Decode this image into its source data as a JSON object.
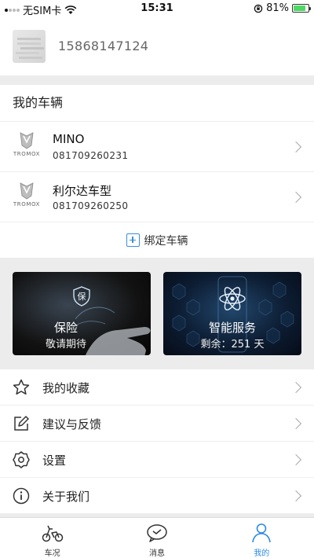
{
  "status_bar": {
    "carrier": "无SIM卡",
    "time": "15:31",
    "battery": "81%",
    "battery_level": 0.81
  },
  "profile": {
    "phone": "15868147124"
  },
  "vehicles_section": {
    "title": "我的车辆",
    "items": [
      {
        "name": "MINO",
        "serial": "081709260231",
        "brand": "TROMOX"
      },
      {
        "name": "利尔达车型",
        "serial": "081709260250",
        "brand": "TROMOX"
      }
    ],
    "bind_label": "绑定车辆"
  },
  "cards": {
    "insurance": {
      "title": "保险",
      "subtitle": "敬请期待",
      "badge": "保"
    },
    "service": {
      "title": "智能服务",
      "subtitle": "剩余：251 天"
    }
  },
  "menu": [
    {
      "label": "我的收藏",
      "icon": "star-icon"
    },
    {
      "label": "建议与反馈",
      "icon": "edit-icon"
    },
    {
      "label": "设置",
      "icon": "gear-icon"
    },
    {
      "label": "关于我们",
      "icon": "info-icon"
    }
  ],
  "tabs": [
    {
      "label": "车况",
      "icon": "scooter-icon",
      "active": false
    },
    {
      "label": "消息",
      "icon": "chat-icon",
      "active": false
    },
    {
      "label": "我的",
      "icon": "user-icon",
      "active": true
    }
  ],
  "colors": {
    "accent": "#2e8ae6",
    "background": "#ececec",
    "battery_green": "#4cd964"
  }
}
